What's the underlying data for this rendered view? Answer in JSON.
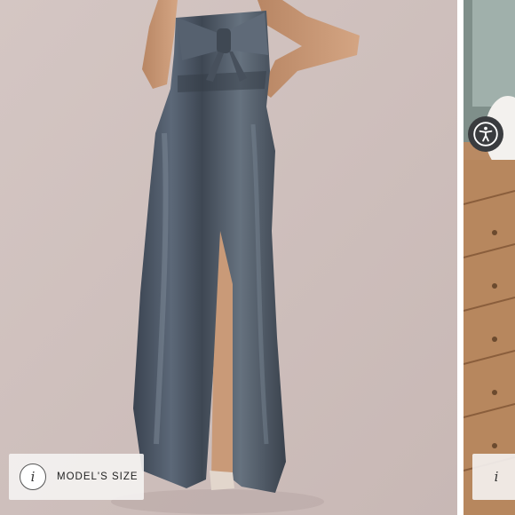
{
  "gallery": {
    "main_image_alt": "Strapless satin maxi dress with bow",
    "info_button": {
      "icon_glyph": "i",
      "label": "MODEL'S SIZE"
    },
    "next_info_button": {
      "icon_glyph": "i"
    }
  },
  "accessibility": {
    "icon": "accessibility-icon"
  },
  "colors": {
    "dress": "#4a5462",
    "backdrop": "#cfc0bd",
    "accessibility_button": "#3a3c3f"
  }
}
